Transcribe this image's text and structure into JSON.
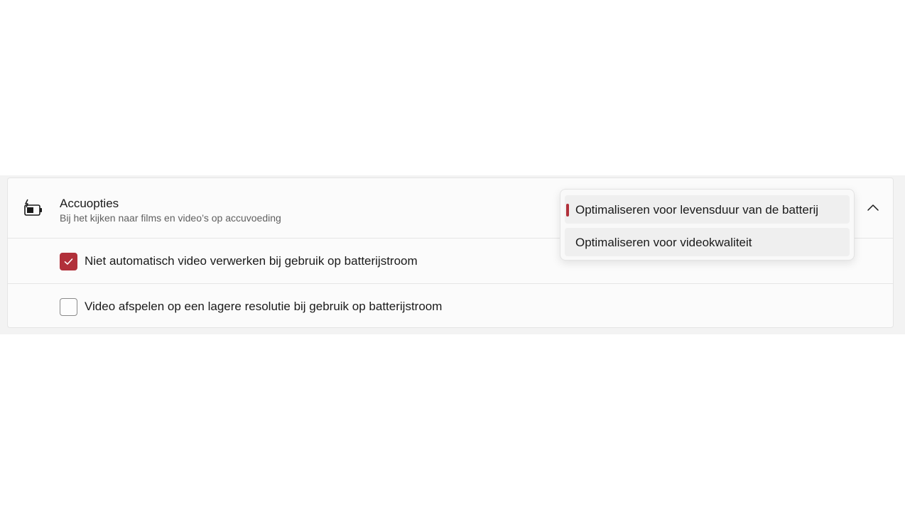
{
  "section": {
    "title": "Accuopties",
    "subtitle": "Bij het kijken naar films en video’s op accuvoeding",
    "icon": "battery-saver-icon",
    "expanded": true
  },
  "options": [
    {
      "label": "Niet automatisch video verwerken bij gebruik op batterijstroom",
      "checked": true
    },
    {
      "label": "Video afspelen op een lagere resolutie bij gebruik op batterijstroom",
      "checked": false
    }
  ],
  "dropdown": {
    "items": [
      {
        "label": "Optimaliseren voor levensduur van de batterij",
        "selected": true
      },
      {
        "label": "Optimaliseren voor videokwaliteit",
        "selected": false
      }
    ]
  },
  "colors": {
    "accent": "#b1303a",
    "card_background": "#fbfbfb",
    "band_background": "#f3f3f3"
  }
}
